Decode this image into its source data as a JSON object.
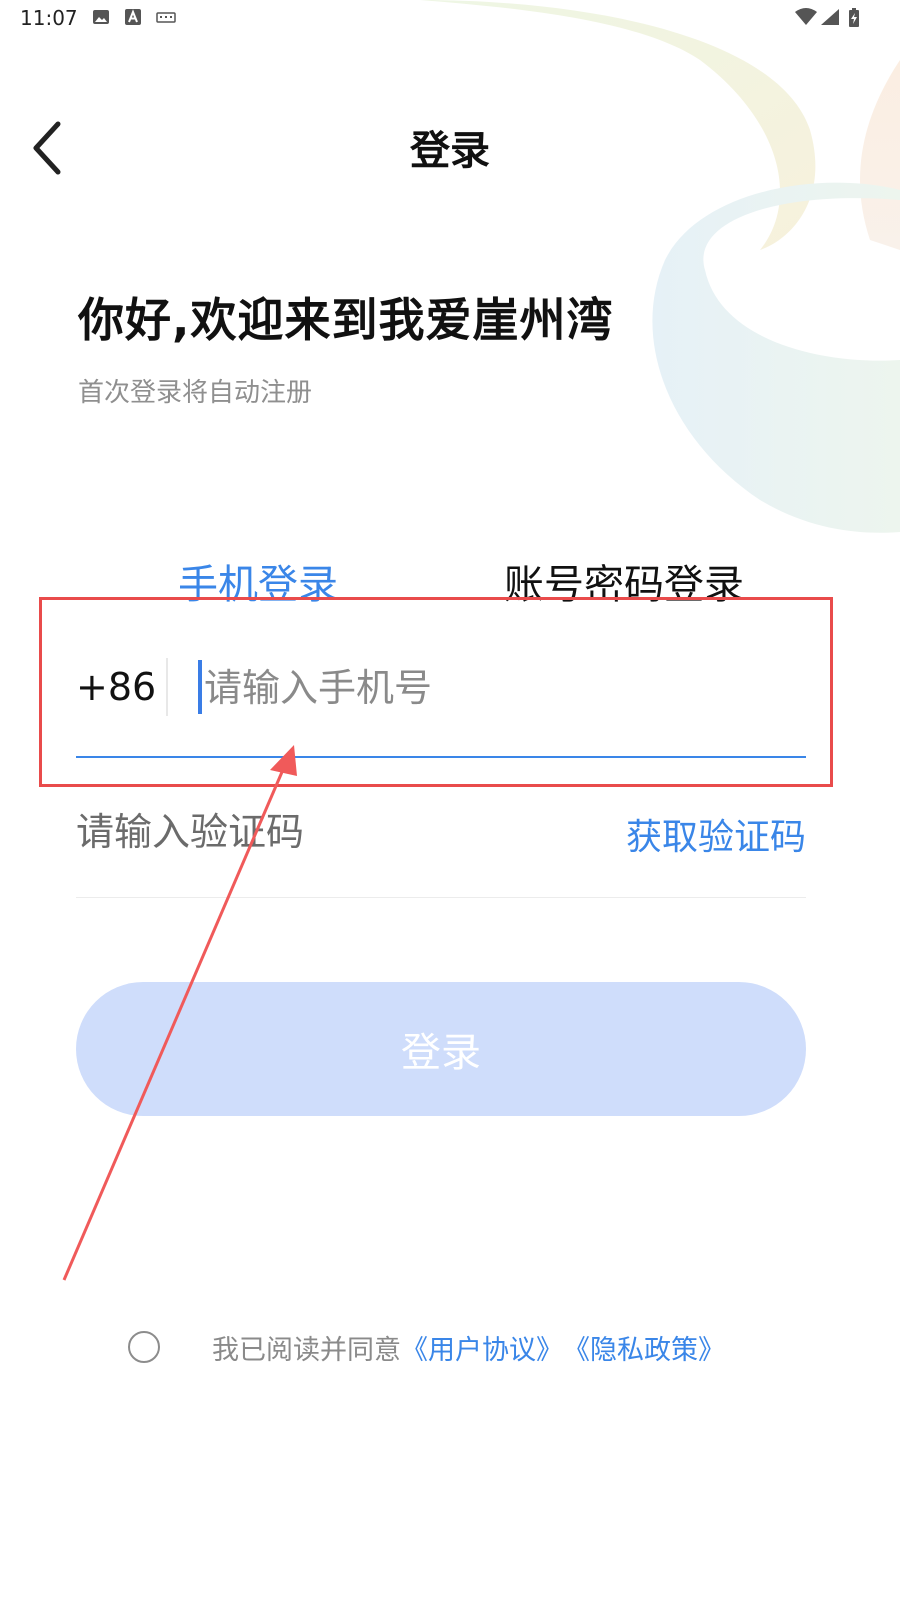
{
  "status_bar": {
    "time": "11:07",
    "left_icons": [
      "image-icon",
      "a-icon",
      "keyboard-icon"
    ],
    "right_icons": [
      "wifi-icon",
      "signal-icon",
      "battery-charging-icon"
    ]
  },
  "header": {
    "title": "登录",
    "back_icon": "chevron-left-icon"
  },
  "welcome": {
    "greeting": "你好,欢迎来到我爱崖州湾",
    "subtitle": "首次登录将自动注册"
  },
  "tabs": [
    {
      "label": "手机登录",
      "active": true
    },
    {
      "label": "账号密码登录",
      "active": false
    }
  ],
  "form": {
    "country_code": "+86",
    "phone_placeholder": "请输入手机号",
    "code_placeholder": "请输入验证码",
    "get_code_label": "获取验证码"
  },
  "login_button": {
    "label": "登录"
  },
  "agreement": {
    "prefix": "我已阅读并同意",
    "user_agreement": "《用户协议》",
    "privacy_policy": "《隐私政策》"
  },
  "colors": {
    "accent": "#3a86e8",
    "button_disabled": "#cfddfb",
    "annotation_red": "#e94b4b"
  }
}
